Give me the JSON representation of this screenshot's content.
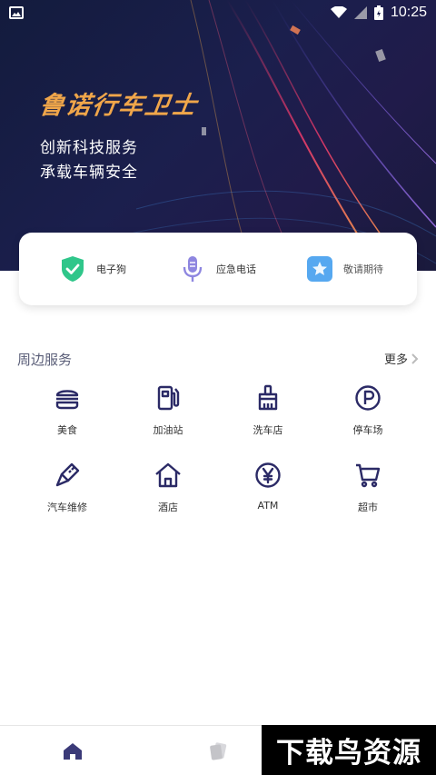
{
  "status_bar": {
    "time": "10:25"
  },
  "hero": {
    "brand": "鲁诺行车卫士",
    "slogan_line1": "创新科技服务",
    "slogan_line2": "承载车辆安全"
  },
  "quick_actions": [
    {
      "label": "电子狗",
      "icon": "shield-check-icon"
    },
    {
      "label": "应急电话",
      "icon": "microphone-icon"
    },
    {
      "label": "敬请期待",
      "icon": "star-icon"
    }
  ],
  "nearby": {
    "title": "周边服务",
    "more": "更多",
    "items": [
      {
        "label": "美食",
        "icon": "burger-icon"
      },
      {
        "label": "加油站",
        "icon": "fuel-pump-icon"
      },
      {
        "label": "洗车店",
        "icon": "car-wash-brush-icon"
      },
      {
        "label": "停车场",
        "icon": "parking-icon"
      },
      {
        "label": "汽车维修",
        "icon": "screwdriver-icon"
      },
      {
        "label": "酒店",
        "icon": "house-icon"
      },
      {
        "label": "ATM",
        "icon": "yen-coin-icon"
      },
      {
        "label": "超市",
        "icon": "shopping-cart-icon"
      }
    ]
  },
  "tab_bar": [
    {
      "icon": "home-icon",
      "active": true
    },
    {
      "icon": "cards-icon",
      "active": false
    }
  ],
  "watermark": "下载鸟资源",
  "colors": {
    "accent": "#2b2a66",
    "brand_orange": "#f0a64a",
    "green_badge": "#2fc68a",
    "blue_badge": "#56a8f0"
  }
}
